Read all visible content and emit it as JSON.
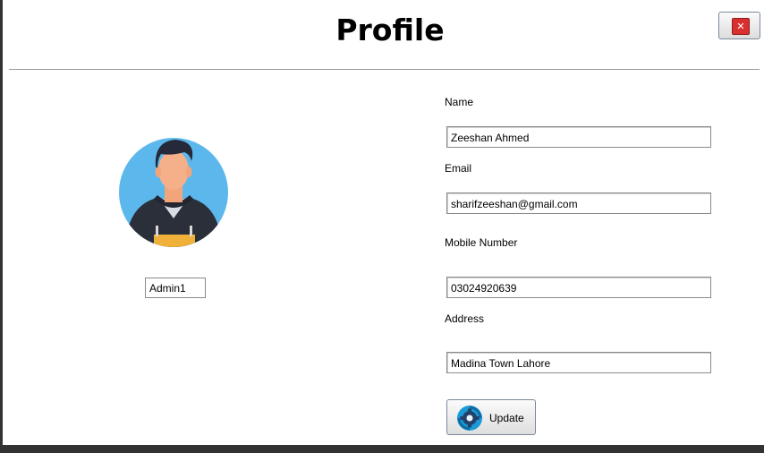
{
  "window": {
    "title": "Profile"
  },
  "header": {
    "close_icon": "close-icon",
    "close_glyph": "✕"
  },
  "profile": {
    "avatar_icon": "user-avatar",
    "username": "Admin1"
  },
  "form": {
    "name_label": "Name",
    "name_value": "Zeeshan Ahmed",
    "email_label": "Email",
    "email_value": "sharifzeeshan@gmail.com",
    "mobile_label": "Mobile Number",
    "mobile_value": "03024920639",
    "address_label": "Address",
    "address_value": "Madina Town Lahore",
    "update_label": "Update",
    "update_icon": "refresh-gear-icon"
  },
  "colors": {
    "avatar_bg": "#5cb8ec",
    "close_red": "#d9302f",
    "accent_blue": "#1a9ad6"
  }
}
